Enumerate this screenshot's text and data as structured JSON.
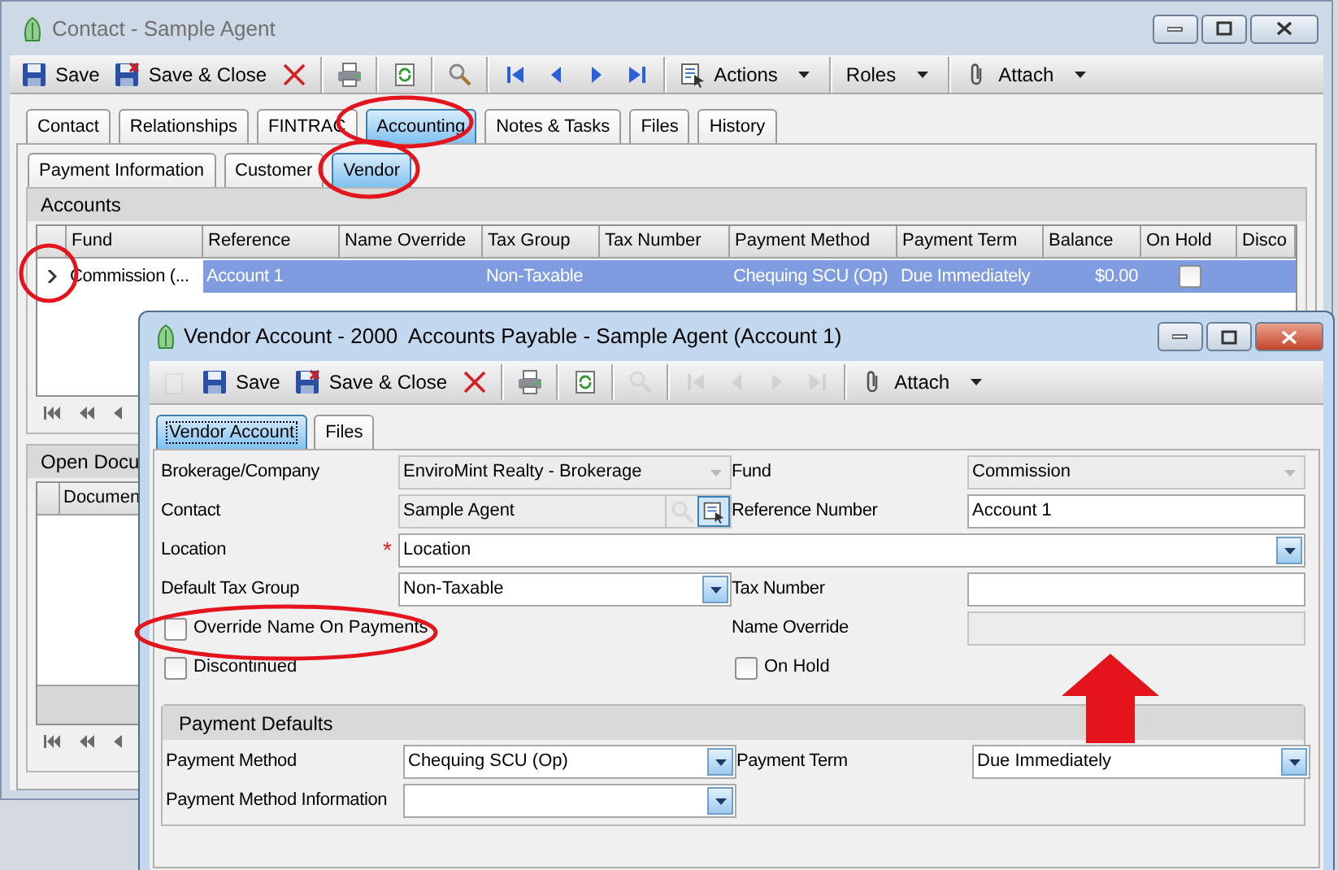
{
  "main_window": {
    "title": "Contact - Sample Agent",
    "toolbar": [
      {
        "kind": "save",
        "label": "Save",
        "disabled": false
      },
      {
        "kind": "save-close",
        "label": "Save & Close",
        "disabled": false
      },
      {
        "kind": "delete",
        "disabled": false
      },
      {
        "kind": "separator"
      },
      {
        "kind": "print",
        "disabled": false
      },
      {
        "kind": "separator"
      },
      {
        "kind": "refresh",
        "disabled": false
      },
      {
        "kind": "separator"
      },
      {
        "kind": "search",
        "disabled": false
      },
      {
        "kind": "separator"
      },
      {
        "kind": "first",
        "disabled": false
      },
      {
        "kind": "prev",
        "disabled": false
      },
      {
        "kind": "next",
        "disabled": false
      },
      {
        "kind": "last",
        "disabled": false
      },
      {
        "kind": "separator"
      },
      {
        "kind": "actions-menu",
        "label": "Actions",
        "disabled": false
      },
      {
        "kind": "separator"
      },
      {
        "kind": "roles-menu",
        "label": "Roles",
        "disabled": false
      },
      {
        "kind": "separator"
      },
      {
        "kind": "attach-menu",
        "label": "Attach",
        "disabled": false
      }
    ],
    "tabs": [
      {
        "label": "Contact",
        "selected": false
      },
      {
        "label": "Relationships",
        "selected": false
      },
      {
        "label": "FINTRAC",
        "selected": false
      },
      {
        "label": "Accounting",
        "selected": true
      },
      {
        "label": "Notes & Tasks",
        "selected": false
      },
      {
        "label": "Files",
        "selected": false
      },
      {
        "label": "History",
        "selected": false
      }
    ],
    "subtabs": [
      {
        "label": "Payment Information",
        "selected": false
      },
      {
        "label": "Customer",
        "selected": false
      },
      {
        "label": "Vendor",
        "selected": true
      }
    ],
    "accounts_panel": {
      "title": "Accounts",
      "columns": [
        "Fund",
        "Reference",
        "Name Override",
        "Tax Group",
        "Tax Number",
        "Payment Method",
        "Payment Term",
        "Balance",
        "On Hold",
        "Disco"
      ],
      "rows": [
        {
          "selected": true,
          "cells": [
            {
              "kind": "text",
              "text": "Commission (...",
              "focused": true
            },
            {
              "kind": "text",
              "text": "Account 1",
              "focused": false
            },
            {
              "kind": "blank"
            },
            {
              "kind": "text",
              "text": "Non-Taxable",
              "focused": false
            },
            {
              "kind": "blank"
            },
            {
              "kind": "text",
              "text": "Chequing SCU (Op)",
              "focused": false
            },
            {
              "kind": "text",
              "text": "Due Immediately",
              "focused": false
            },
            {
              "kind": "number",
              "text": "$0.00",
              "focused": false
            },
            {
              "kind": "checkbox",
              "checked": false
            },
            {
              "kind": "blank"
            }
          ]
        }
      ]
    },
    "open_documents_panel": {
      "title": "Open Docu",
      "columns": [
        "Documen"
      ]
    }
  },
  "dialog": {
    "title": "Vendor Account - 2000  Accounts Payable - Sample Agent (Account 1)",
    "toolbar": [
      {
        "kind": "new",
        "disabled": true
      },
      {
        "kind": "save",
        "label": "Save",
        "disabled": false
      },
      {
        "kind": "save-close",
        "label": "Save & Close",
        "disabled": false
      },
      {
        "kind": "delete",
        "disabled": false
      },
      {
        "kind": "separator"
      },
      {
        "kind": "print",
        "disabled": false
      },
      {
        "kind": "separator"
      },
      {
        "kind": "refresh",
        "disabled": false
      },
      {
        "kind": "separator"
      },
      {
        "kind": "search",
        "disabled": true
      },
      {
        "kind": "separator"
      },
      {
        "kind": "first",
        "disabled": true
      },
      {
        "kind": "prev",
        "disabled": true
      },
      {
        "kind": "next",
        "disabled": true
      },
      {
        "kind": "last",
        "disabled": true
      },
      {
        "kind": "separator"
      },
      {
        "kind": "attach-menu",
        "label": "Attach",
        "disabled": false
      }
    ],
    "tabs": [
      {
        "label": "Vendor Account",
        "selected": true
      },
      {
        "label": "Files",
        "selected": false
      }
    ],
    "rows": [
      {
        "cells": [
          {
            "kind": "combo",
            "label": "Brokerage/Company",
            "value": "EnviroMint Realty - Brokerage",
            "disabled": true
          },
          {
            "kind": "combo",
            "label": "Fund",
            "value": "Commission",
            "disabled": true
          }
        ]
      },
      {
        "cells": [
          {
            "kind": "lookup",
            "label": "Contact",
            "value": "Sample Agent",
            "disabled": true
          },
          {
            "kind": "text",
            "label": "Reference Number",
            "value": "Account 1",
            "disabled": false
          }
        ]
      },
      {
        "cells": [
          {
            "kind": "combo",
            "label": "Location",
            "value": "Location",
            "disabled": false,
            "required_mark": "*",
            "wide": true
          }
        ]
      },
      {
        "cells": [
          {
            "kind": "combo",
            "label": "Default Tax Group",
            "value": "Non-Taxable",
            "disabled": false
          },
          {
            "kind": "text",
            "label": "Tax Number",
            "disabled": false
          }
        ]
      },
      {
        "cells": [
          {
            "kind": "checkbox",
            "label": "Override Name On Payments",
            "checked": false
          },
          {
            "kind": "text",
            "label": "Name Override",
            "disabled": true
          }
        ]
      },
      {
        "cells": [
          {
            "kind": "checkbox",
            "label": "Discontinued",
            "checked": false
          },
          {
            "kind": "checkbox",
            "label": "On Hold",
            "checked": false
          }
        ]
      }
    ],
    "payment_defaults": {
      "title": "Payment Defaults",
      "rows": [
        {
          "cells": [
            {
              "kind": "combo",
              "label": "Payment Method",
              "value": "Chequing SCU (Op)",
              "disabled": false
            },
            {
              "kind": "combo",
              "label": "Payment Term",
              "value": "Due Immediately",
              "disabled": false
            }
          ]
        },
        {
          "cells": [
            {
              "kind": "combo",
              "label": "Payment Method Information",
              "disabled": false
            }
          ]
        }
      ]
    }
  }
}
